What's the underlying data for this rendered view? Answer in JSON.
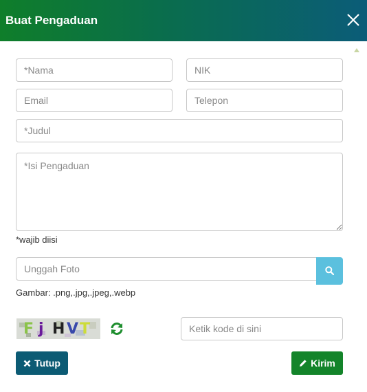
{
  "modal": {
    "title": "Buat Pengaduan"
  },
  "form": {
    "nama_placeholder": "*Nama",
    "nik_placeholder": "NIK",
    "email_placeholder": "Email",
    "telepon_placeholder": "Telepon",
    "judul_placeholder": "*Judul",
    "isi_placeholder": "*Isi Pengaduan",
    "required_note": "*wajib diisi",
    "upload_placeholder": "Unggah Foto",
    "file_types_note": "Gambar: .png,.jpg,.jpeg,.webp",
    "captcha_placeholder": "Ketik kode di sini"
  },
  "captcha": {
    "chars": [
      "F",
      "j",
      "H",
      "V",
      "T"
    ],
    "colors": [
      "#8bc34a",
      "#6a1b9a",
      "#222222",
      "#3949ab",
      "#cddc39"
    ]
  },
  "buttons": {
    "close_label": "Tutup",
    "send_label": "Kirim"
  },
  "icons": {
    "close": "close-icon",
    "search": "search-icon",
    "refresh": "refresh-icon",
    "times": "times-icon",
    "pencil": "pencil-icon"
  },
  "colors": {
    "header_start": "#0f7e2a",
    "header_end": "#0b5c78",
    "upload_button": "#5bc0de",
    "close_button": "#0c5b74",
    "send_button": "#13842a",
    "refresh_icon": "#1e8e2e"
  }
}
